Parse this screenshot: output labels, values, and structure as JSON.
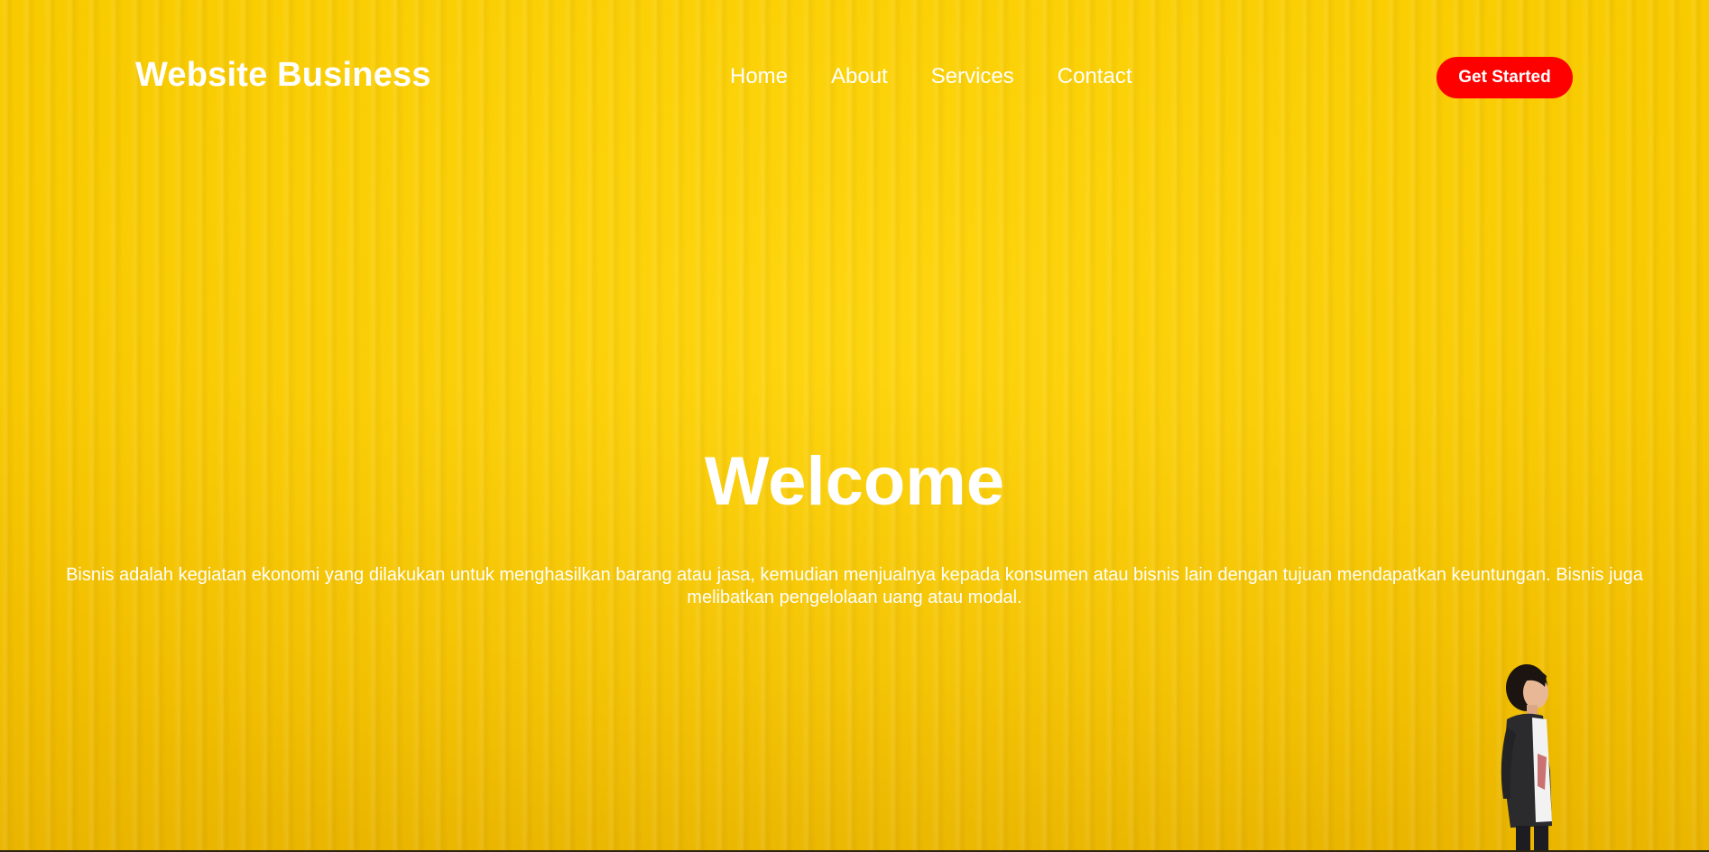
{
  "header": {
    "brand": "Website Business",
    "nav": [
      {
        "label": "Home"
      },
      {
        "label": "About"
      },
      {
        "label": "Services"
      },
      {
        "label": "Contact"
      }
    ],
    "cta_label": "Get Started"
  },
  "hero": {
    "title": "Welcome",
    "description": "Bisnis adalah kegiatan ekonomi yang dilakukan untuk menghasilkan barang atau jasa, kemudian menjualnya kepada konsumen atau bisnis lain dengan tujuan mendapatkan keuntungan. Bisnis juga melibatkan pengelolaan uang atau modal."
  },
  "colors": {
    "background": "#ffd400",
    "accent": "#ff0000",
    "text": "#ffffff"
  }
}
